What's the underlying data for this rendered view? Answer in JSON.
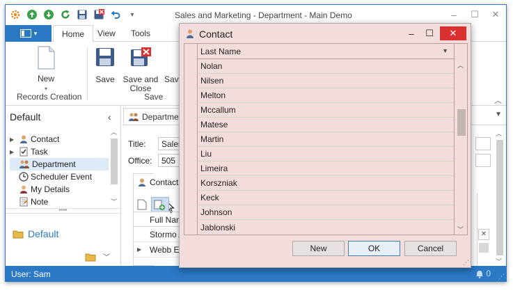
{
  "window": {
    "title": "Sales and Marketing - Department - Main Demo",
    "minimize": "–",
    "maximize": "☐",
    "close": "✕"
  },
  "qat_icons": [
    "gear-icon",
    "up-arrow-icon",
    "down-arrow-icon",
    "refresh-icon",
    "save-icon",
    "save-close-icon",
    "undo-icon",
    "dropdown-icon"
  ],
  "ribbon": {
    "tabs": [
      "Home",
      "View",
      "Tools"
    ],
    "active_tab": "Home",
    "new_label": "New",
    "save_label": "Save",
    "save_close_label_1": "Save and",
    "save_close_label_2": "Close",
    "save_cut_label": "Sav",
    "group_records_creation": "Records Creation",
    "group_save": "Save"
  },
  "nav": {
    "header": "Default",
    "items": [
      {
        "label": "Contact",
        "icon": "contact-icon",
        "expandable": true
      },
      {
        "label": "Task",
        "icon": "task-icon",
        "expandable": true
      },
      {
        "label": "Department",
        "icon": "department-icon",
        "expandable": false
      },
      {
        "label": "Scheduler Event",
        "icon": "clock-icon",
        "expandable": false
      },
      {
        "label": "My Details",
        "icon": "user-icon",
        "expandable": false
      },
      {
        "label": "Note",
        "icon": "note-icon",
        "expandable": false
      }
    ],
    "selected": "Department",
    "group_label": "Default",
    "dots": "•••••"
  },
  "main": {
    "doc_tab": "Department",
    "title_label": "Title:",
    "title_value": "Sales and Marketing",
    "office_label": "Office:",
    "office_value": "505",
    "contacts_tab": "Contacts",
    "full_name_header": "Full Name",
    "rows": [
      "Stormo Amanda",
      "Webb Ernest"
    ]
  },
  "status": {
    "user": "User: Sam",
    "notifications": "0"
  },
  "dialog": {
    "title": "Contact",
    "column_header": "Last Name",
    "rows": [
      "Nolan",
      "Nilsen",
      "Melton",
      "Mccallum",
      "Matese",
      "Martin",
      "Liu",
      "Limeira",
      "Korszniak",
      "Keck",
      "Johnson",
      "Jablonski"
    ],
    "new_button": "New",
    "ok_button": "OK",
    "cancel_button": "Cancel"
  },
  "colors": {
    "accent": "#2b78c5",
    "dialog_bg": "#f2dcdc",
    "close_red": "#d9312f",
    "selection": "#dce9f7"
  }
}
